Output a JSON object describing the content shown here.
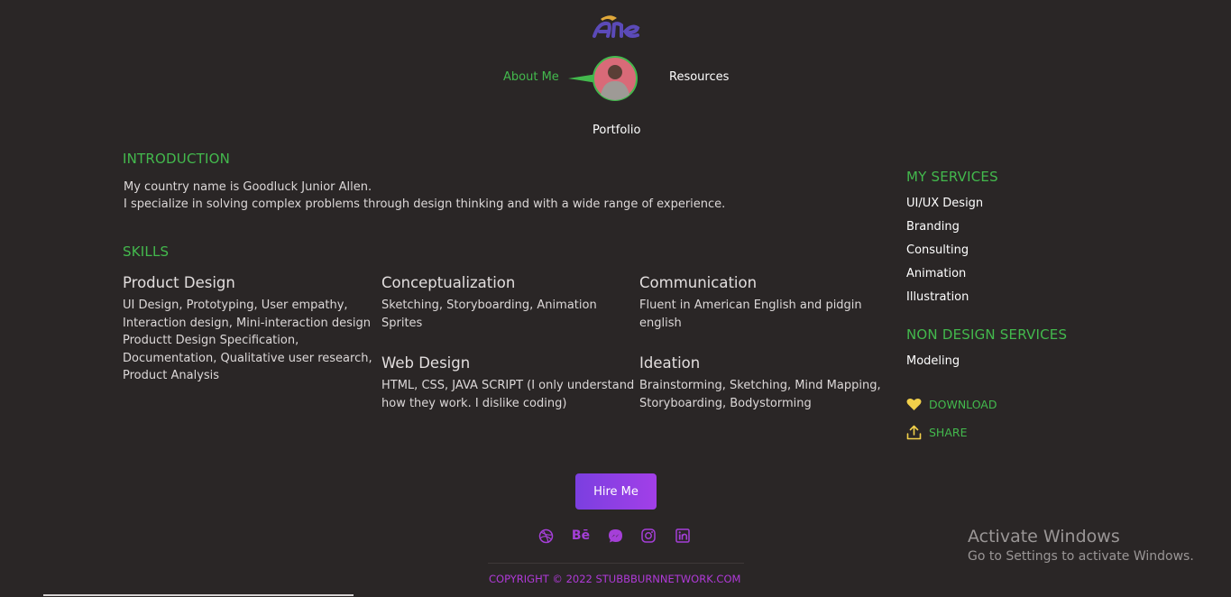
{
  "nav": {
    "about": "About Me",
    "resources": "Resources",
    "portfolio": "Portfolio"
  },
  "intro": {
    "title": "INTRODUCTION",
    "line1": "My country name is Goodluck Junior Allen.",
    "line2": "I specialize in solving complex problems through design thinking and with a wide range of experience."
  },
  "skills": {
    "title": "SKILLS",
    "items": [
      {
        "name": "Product Design",
        "lines": [
          "UI Design, Prototyping, User empathy,",
          "Interaction design, Mini-interaction design",
          "Productt Design Specification,",
          "Documentation, Qualitative user research,",
          "Product Analysis"
        ]
      },
      {
        "name": "Conceptualization",
        "lines": [
          "Sketching, Storyboarding, Animation",
          "Sprites"
        ]
      },
      {
        "name": "Communication",
        "lines": [
          "Fluent in American English and pidgin",
          "english"
        ]
      },
      {
        "name": "Web Design",
        "lines": [
          "HTML, CSS, JAVA SCRIPT (I only understand",
          "how they work. I dislike coding)"
        ]
      },
      {
        "name": "Ideation",
        "lines": [
          "Brainstorming, Sketching, Mind Mapping,",
          "Storyboarding, Bodystorming"
        ]
      }
    ]
  },
  "services": {
    "title": "MY SERVICES",
    "items": [
      "UI/UX Design",
      "Branding",
      "Consulting",
      "Animation",
      "Illustration"
    ],
    "non_title": "NON DESIGN SERVICES",
    "non_items": [
      "Modeling"
    ]
  },
  "actions": {
    "download": "DOWNLOAD",
    "share": "SHARE"
  },
  "hire_label": "Hire Me",
  "social_icons": [
    "dribbble-icon",
    "behance-icon",
    "messenger-icon",
    "instagram-icon",
    "linkedin-icon"
  ],
  "social_behance_text": "Bē",
  "copyright": "COPYRIGHT © 2022 STUBBBURNNETWORK.COM",
  "windows": {
    "title": "Activate Windows",
    "subtitle": "Go to Settings to activate Windows."
  },
  "colors": {
    "background": "#2a2626",
    "accent_green": "#43b94d",
    "accent_purple": "#a53fd8",
    "button_gradient_start": "#7b3fe0",
    "button_gradient_end": "#a23fe8"
  }
}
